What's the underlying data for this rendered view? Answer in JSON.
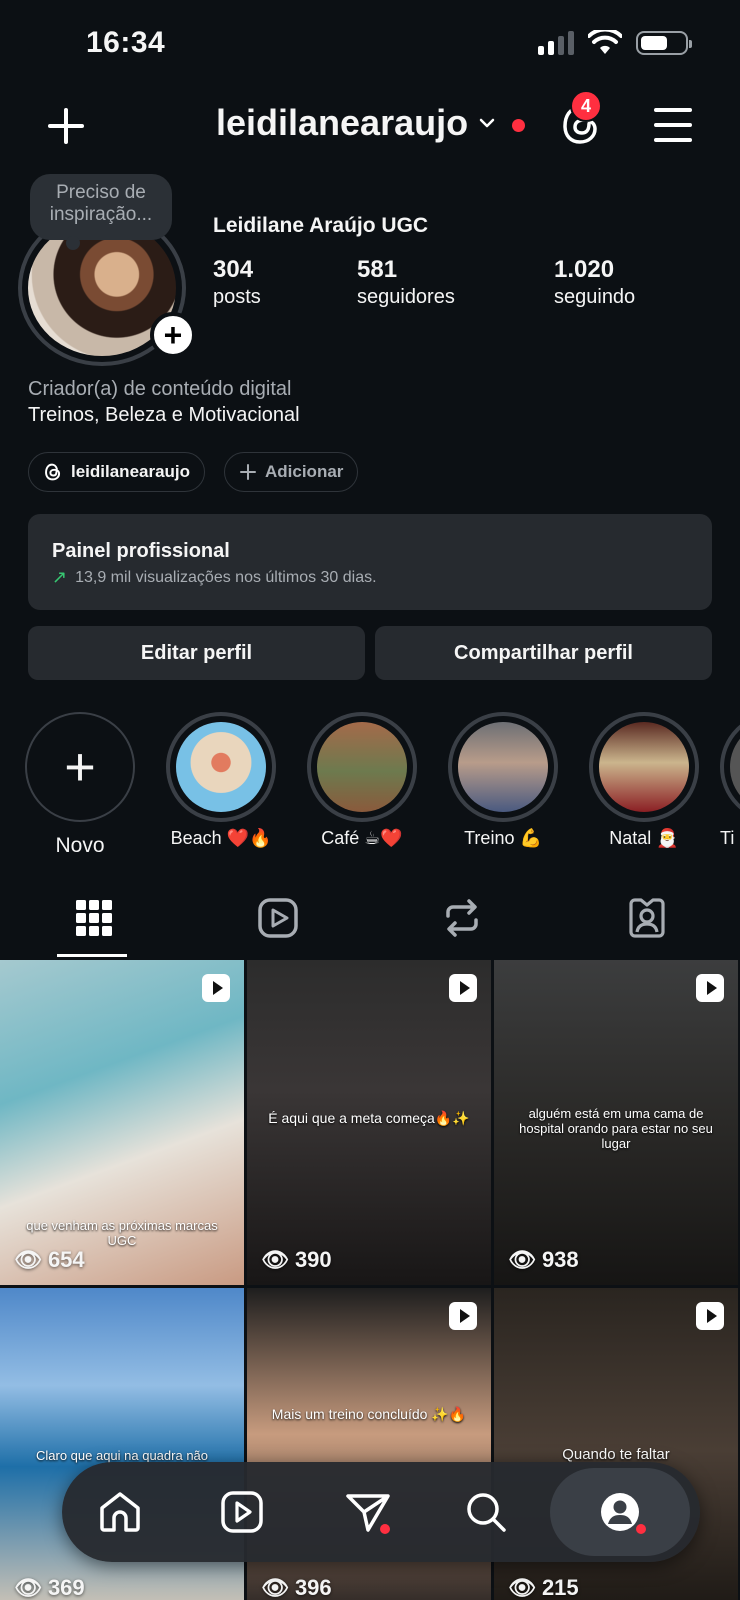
{
  "status_bar": {
    "time": "16:34"
  },
  "header": {
    "username": "leidilanearaujo",
    "notification_count": "4"
  },
  "profile": {
    "note": "Preciso de inspiração...",
    "full_name": "Leidilane Araújo UGC",
    "stats": [
      {
        "value": "304",
        "label": "posts"
      },
      {
        "value": "581",
        "label": "seguidores"
      },
      {
        "value": "1.020",
        "label": "seguindo"
      }
    ],
    "category": "Criador(a) de conteúdo digital",
    "bio": "Treinos, Beleza e Motivacional",
    "threads_chip": "leidilanearaujo",
    "add_chip": "Adicionar"
  },
  "pro_panel": {
    "title": "Painel profissional",
    "subtitle": "13,9 mil visualizações nos últimos 30 dias."
  },
  "buttons": {
    "edit": "Editar perfil",
    "share": "Compartilhar perfil"
  },
  "highlights": [
    {
      "label": "Novo"
    },
    {
      "label": "Beach ❤️🔥"
    },
    {
      "label": "Café ☕❤️"
    },
    {
      "label": "Treino 💪"
    },
    {
      "label": "Natal 🎅"
    },
    {
      "label": "Ti"
    }
  ],
  "grid": [
    {
      "views": "654",
      "caption": "que venham as próximas marcas UGC"
    },
    {
      "views": "390",
      "caption": "É aqui que a meta começa🔥✨"
    },
    {
      "views": "938",
      "caption": "alguém está em uma cama de hospital orando para estar no seu lugar"
    },
    {
      "views": "369",
      "caption": "Claro que aqui na quadra não"
    },
    {
      "views": "396",
      "caption": "Mais um treino concluído ✨🔥"
    },
    {
      "views": "215",
      "caption": "Quando te faltar"
    }
  ],
  "colors": {
    "background": "#0c1014",
    "surface": "#262a2f",
    "accent_red": "#ff2f40",
    "trend_green": "#37c772"
  }
}
